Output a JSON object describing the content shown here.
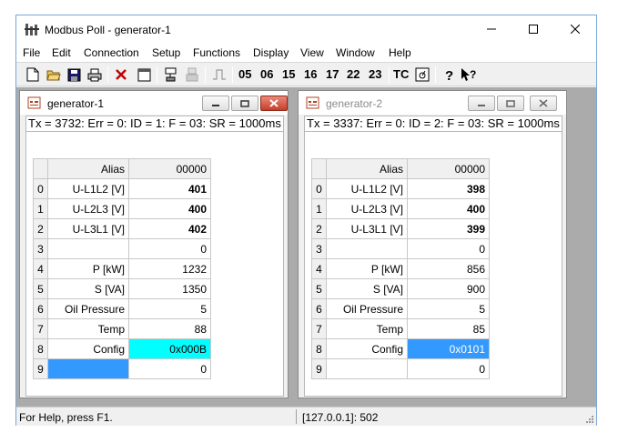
{
  "window": {
    "title": "Modbus Poll - generator-1"
  },
  "menu": [
    "File",
    "Edit",
    "Connection",
    "Setup",
    "Functions",
    "Display",
    "View",
    "Window",
    "Help"
  ],
  "toolbar": {
    "fc_buttons": [
      "05",
      "06",
      "15",
      "16",
      "17",
      "22",
      "23"
    ],
    "tc_label": "TC"
  },
  "children": [
    {
      "name": "generator-1",
      "status": "Tx = 3732: Err = 0: ID = 1: F = 03: SR = 1000ms",
      "header": {
        "alias": "Alias",
        "address": "00000"
      },
      "rows": [
        {
          "n": "0",
          "alias": "U-L1L2 [V]",
          "value": "401"
        },
        {
          "n": "1",
          "alias": "U-L2L3 [V]",
          "value": "400"
        },
        {
          "n": "2",
          "alias": "U-L3L1 [V]",
          "value": "402"
        },
        {
          "n": "3",
          "alias": "",
          "value": "0"
        },
        {
          "n": "4",
          "alias": "P [kW]",
          "value": "1232"
        },
        {
          "n": "5",
          "alias": "S [VA]",
          "value": "1350"
        },
        {
          "n": "6",
          "alias": "Oil Pressure",
          "value": "5"
        },
        {
          "n": "7",
          "alias": "Temp",
          "value": "88"
        },
        {
          "n": "8",
          "alias": "Config",
          "value": "0x000B"
        },
        {
          "n": "9",
          "alias": "",
          "value": "0"
        }
      ]
    },
    {
      "name": "generator-2",
      "status": "Tx = 3337: Err = 0: ID = 2: F = 03: SR = 1000ms",
      "header": {
        "alias": "Alias",
        "address": "00000"
      },
      "rows": [
        {
          "n": "0",
          "alias": "U-L1L2 [V]",
          "value": "398"
        },
        {
          "n": "1",
          "alias": "U-L2L3 [V]",
          "value": "400"
        },
        {
          "n": "2",
          "alias": "U-L3L1 [V]",
          "value": "399"
        },
        {
          "n": "3",
          "alias": "",
          "value": "0"
        },
        {
          "n": "4",
          "alias": "P [kW]",
          "value": "856"
        },
        {
          "n": "5",
          "alias": "S [VA]",
          "value": "900"
        },
        {
          "n": "6",
          "alias": "Oil Pressure",
          "value": "5"
        },
        {
          "n": "7",
          "alias": "Temp",
          "value": "85"
        },
        {
          "n": "8",
          "alias": "Config",
          "value": "0x0101"
        },
        {
          "n": "9",
          "alias": "",
          "value": "0"
        }
      ]
    }
  ],
  "statusbar": {
    "help": "For Help, press F1.",
    "connection": "[127.0.0.1]: 502"
  },
  "colors": {
    "highlight_cyan": "#00ffff",
    "highlight_blue": "#3399ff"
  }
}
